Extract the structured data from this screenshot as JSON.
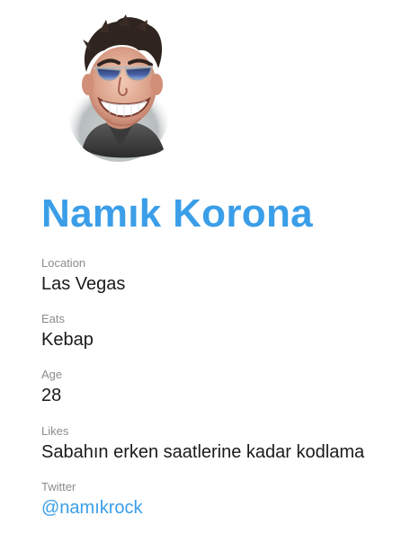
{
  "profile": {
    "name": "Namık Korona",
    "accent_color": "#3b9ee8"
  },
  "fields": {
    "location": {
      "label": "Location",
      "value": "Las Vegas"
    },
    "eats": {
      "label": "Eats",
      "value": "Kebap"
    },
    "age": {
      "label": "Age",
      "value": "28"
    },
    "likes": {
      "label": "Likes",
      "value": "Sabahın erken saatlerine kadar kodlama"
    },
    "twitter": {
      "label": "Twitter",
      "value": "@namıkrock"
    }
  }
}
